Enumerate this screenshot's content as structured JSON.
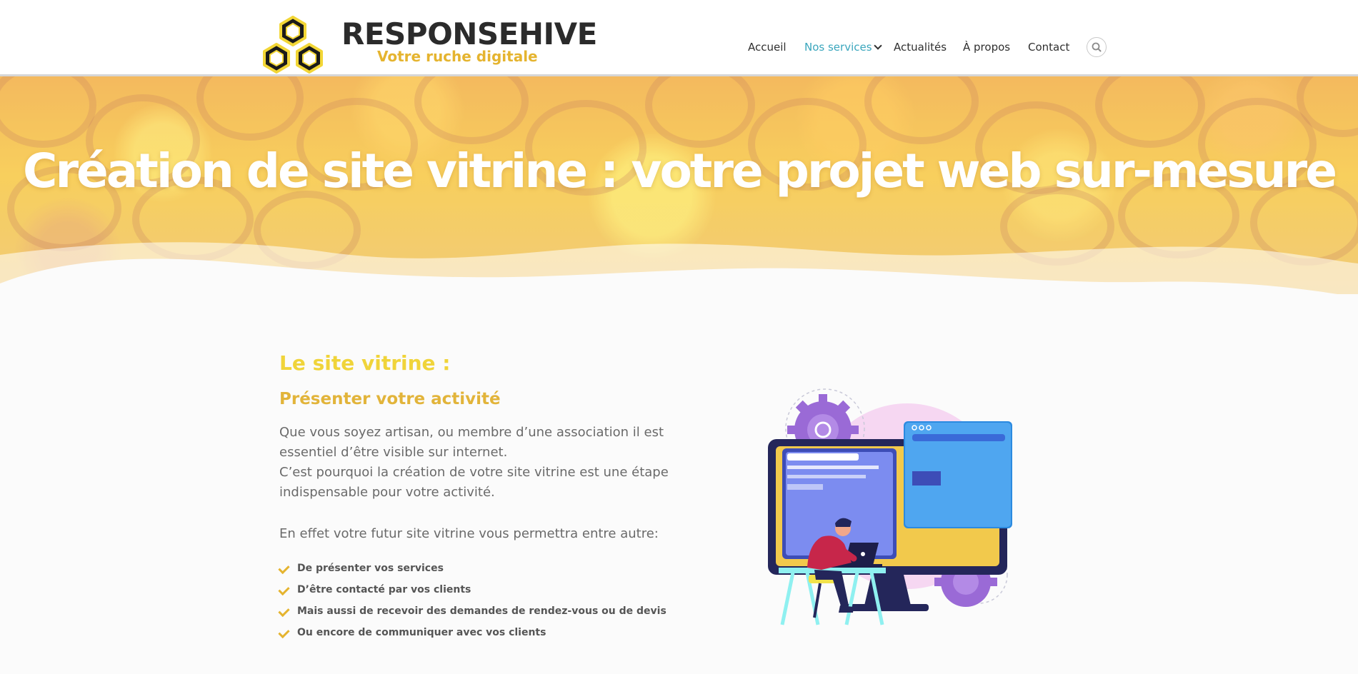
{
  "brand": {
    "name": "RESPONSEHIVE",
    "tagline": "Votre ruche digitale"
  },
  "nav": {
    "items": [
      {
        "label": "Accueil",
        "active": false
      },
      {
        "label": "Nos services",
        "active": true
      },
      {
        "label": "Actualités",
        "active": false
      },
      {
        "label": "À propos",
        "active": false
      },
      {
        "label": "Contact",
        "active": false
      }
    ],
    "search_icon": "search-icon"
  },
  "hero": {
    "title": "Création de site vitrine : votre projet web sur-mesure"
  },
  "content": {
    "heading": "Le site vitrine :",
    "subheading": "Présenter votre activité",
    "paragraph1_line1": "Que vous soyez artisan, ou membre d’une association il est essentiel d’être visible sur internet.",
    "paragraph1_line2": "C’est pourquoi la création de votre site vitrine est une étape indispensable pour votre activité.",
    "paragraph2": "En effet votre futur site vitrine vous permettra entre autre:",
    "bullets": [
      "De présenter vos services",
      "D’être contacté par vos clients",
      "Mais aussi de recevoir des demandes de rendez-vous ou de devis",
      "Ou encore de communiquer avec vos clients"
    ]
  },
  "colors": {
    "accent_yellow": "#f0d43a",
    "accent_gold": "#e2b43a",
    "nav_active": "#3aa6bd",
    "text_dark": "#2b2b2b",
    "text_body": "#6a6a6a"
  }
}
